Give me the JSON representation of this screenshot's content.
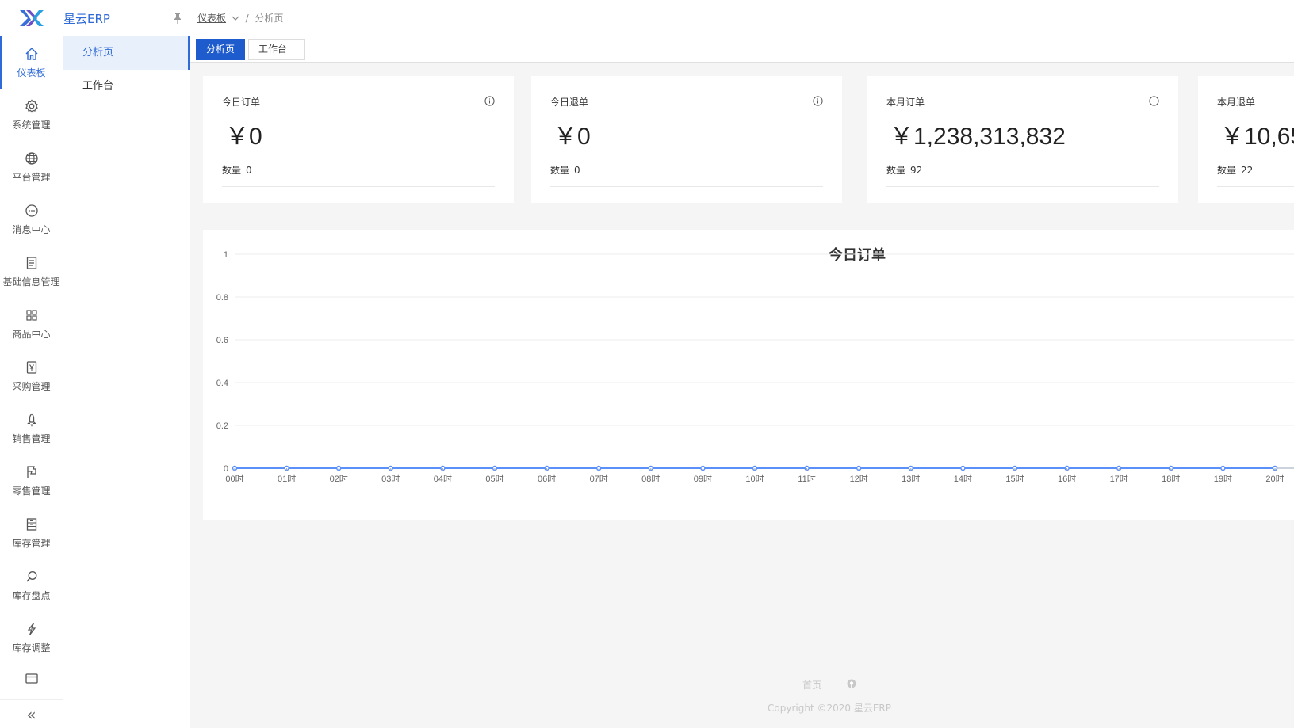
{
  "brand": {
    "name": "星云ERP"
  },
  "rail": [
    {
      "label": "仪表板",
      "icon": "home-icon",
      "active": true
    },
    {
      "label": "系统管理",
      "icon": "gear-icon"
    },
    {
      "label": "平台管理",
      "icon": "globe-icon"
    },
    {
      "label": "消息中心",
      "icon": "message-icon"
    },
    {
      "label": "基础信息管理",
      "icon": "document-icon"
    },
    {
      "label": "商品中心",
      "icon": "grid-icon"
    },
    {
      "label": "采购管理",
      "icon": "yen-icon"
    },
    {
      "label": "销售管理",
      "icon": "rocket-icon"
    },
    {
      "label": "零售管理",
      "icon": "flag-icon"
    },
    {
      "label": "库存管理",
      "icon": "inventory-icon"
    },
    {
      "label": "库存盘点",
      "icon": "search-icon"
    },
    {
      "label": "库存调整",
      "icon": "lightning-icon"
    },
    {
      "label": "",
      "icon": "card-icon"
    }
  ],
  "submenu": [
    {
      "label": "分析页",
      "active": true
    },
    {
      "label": "工作台"
    }
  ],
  "breadcrumb": {
    "root": "仪表板",
    "separator": "/",
    "current": "分析页"
  },
  "tabs": [
    {
      "label": "分析页",
      "active": true
    },
    {
      "label": "工作台"
    }
  ],
  "cards": [
    {
      "title": "今日订单",
      "value": "￥0",
      "count_label": "数量",
      "count": "0"
    },
    {
      "title": "今日退单",
      "value": "￥0",
      "count_label": "数量",
      "count": "0"
    },
    {
      "title": "本月订单",
      "value": "￥1,238,313,832",
      "count_label": "数量",
      "count": "92"
    },
    {
      "title": "本月退单",
      "value": "￥10,65",
      "count_label": "数量",
      "count": "22"
    }
  ],
  "chart_data": {
    "type": "line",
    "title": "今日订单",
    "categories": [
      "00时",
      "01时",
      "02时",
      "03时",
      "04时",
      "05时",
      "06时",
      "07时",
      "08时",
      "09时",
      "10时",
      "11时",
      "12时",
      "13时",
      "14时",
      "15时",
      "16时",
      "17时",
      "18时",
      "19时",
      "20时"
    ],
    "values": [
      0,
      0,
      0,
      0,
      0,
      0,
      0,
      0,
      0,
      0,
      0,
      0,
      0,
      0,
      0,
      0,
      0,
      0,
      0,
      0,
      0
    ],
    "yticks": [
      "0",
      "0.2",
      "0.4",
      "0.6",
      "0.8",
      "1"
    ],
    "ylim": [
      0,
      1
    ],
    "grid": true,
    "color": "#5b8ff9"
  },
  "footer": {
    "link_home": "首页",
    "copyright": "Copyright ©2020 星云ERP"
  },
  "colors": {
    "primary": "#2f6ad6",
    "tab_active": "#1e5bcc"
  }
}
